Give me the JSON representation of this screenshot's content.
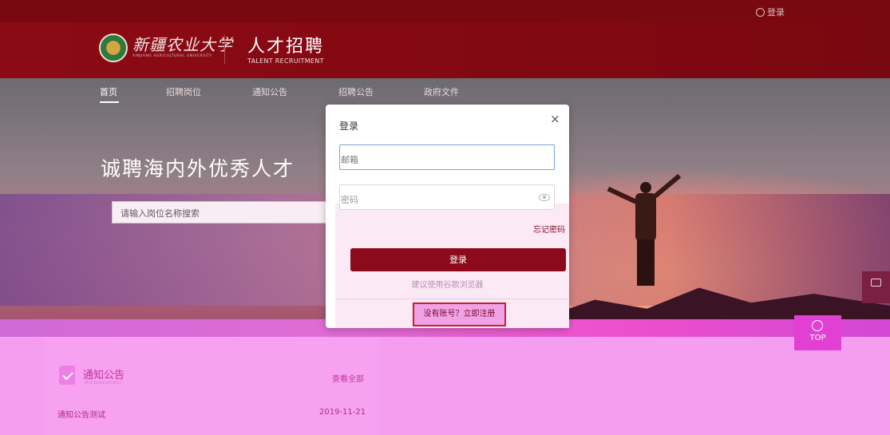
{
  "topbar": {
    "login_label": "登录"
  },
  "header": {
    "university_name": "新疆农业大学",
    "university_name_en": "XINJIANG AGRICULTURAL UNIVERSITY",
    "title": "人才招聘",
    "subtitle": "TALENT RECRUITMENT"
  },
  "nav": {
    "items": [
      {
        "label": "首页",
        "active": true
      },
      {
        "label": "招聘岗位"
      },
      {
        "label": "通知公告"
      },
      {
        "label": "招聘公告"
      },
      {
        "label": "政府文件"
      }
    ]
  },
  "hero": {
    "title": "诚聘海内外优秀人才",
    "search_placeholder": "请输入岗位名称搜索"
  },
  "announcements": {
    "title": "通知公告",
    "subtitle": "Announcement",
    "view_all": "查看全部",
    "rows": [
      {
        "title": "通知公告测试",
        "date": "2019-11-21"
      }
    ]
  },
  "side": {
    "top_label": "TOP"
  },
  "modal": {
    "title": "登录",
    "close": "×",
    "email_placeholder": "邮箱",
    "password_placeholder": "密码",
    "forgot": "忘记密码",
    "login_button": "登录",
    "browser_tip": "建议使用谷歌浏览器",
    "register": "没有账号？立即注册"
  }
}
